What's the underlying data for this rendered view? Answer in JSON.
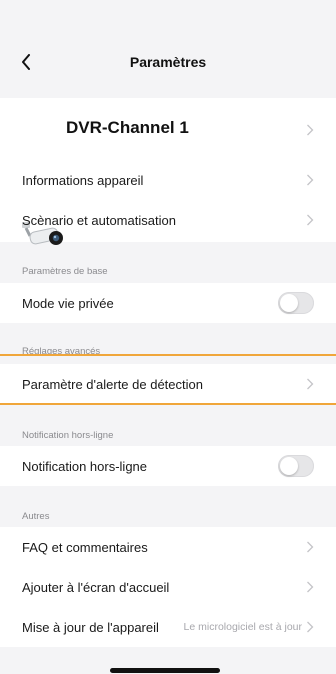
{
  "header": {
    "title": "Paramètres",
    "back_icon": "chevron-left-icon"
  },
  "device": {
    "name": "DVR-Channel 1",
    "icon": "camera-icon"
  },
  "rows": {
    "device_info": "Informations appareil",
    "scenario": "Scènario et automatisation",
    "privacy_mode": "Mode vie privée",
    "detection_alert": "Paramètre d'alerte de détection",
    "offline_notification": "Notification hors-ligne",
    "faq": "FAQ et commentaires",
    "add_home": "Ajouter à l'écran d'accueil",
    "update": "Mise à jour de l'appareil",
    "update_value": "Le micrologiciel est à jour"
  },
  "sections": {
    "basic": "Paramètres de base",
    "advanced": "Réglages avancés",
    "offline": "Notification hors-ligne",
    "others": "Autres"
  },
  "toggles": {
    "privacy_mode_on": false,
    "offline_notification_on": false
  },
  "colors": {
    "highlight": "#f0a63a",
    "background": "#f4f4f6",
    "card": "#ffffff"
  }
}
